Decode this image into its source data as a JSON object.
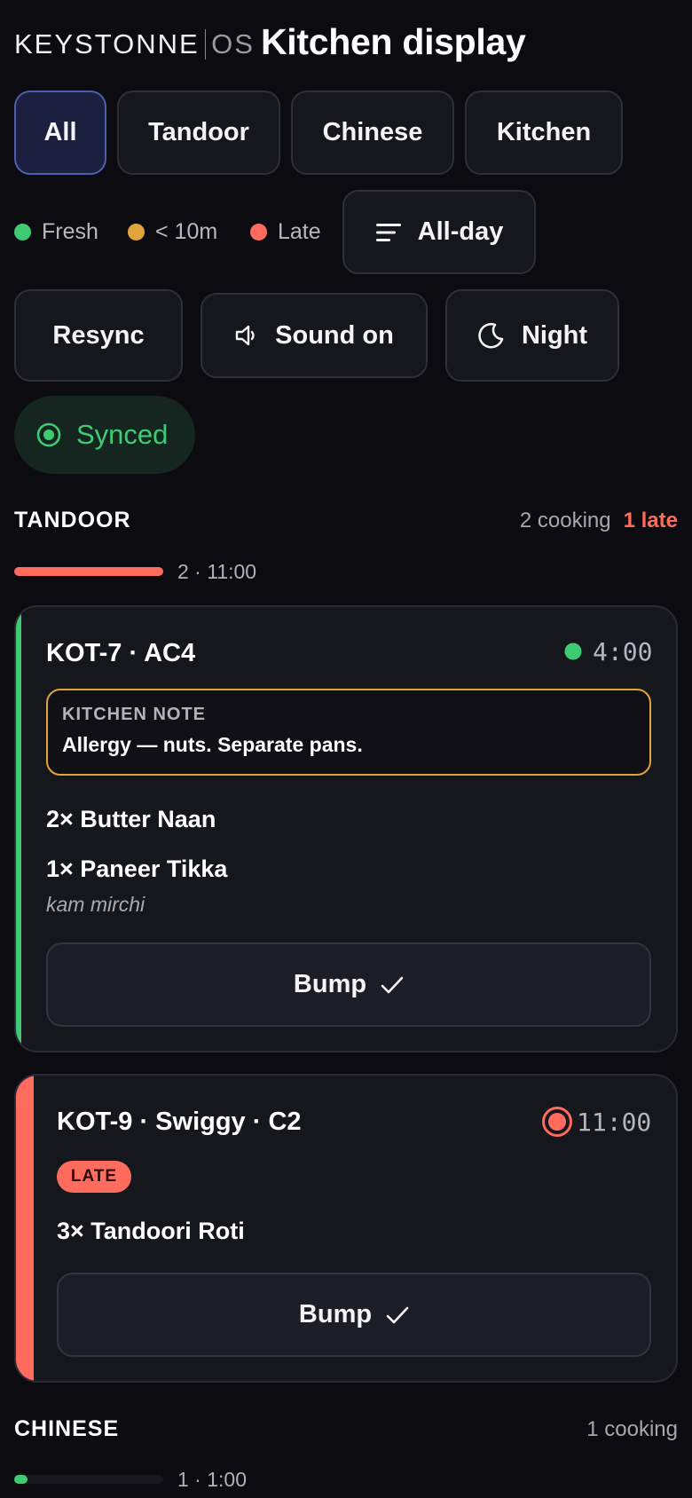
{
  "header": {
    "brand": "KEYSTONNE",
    "brand_suffix": "OS",
    "title": "Kitchen display"
  },
  "stations": [
    {
      "label": "All",
      "active": true
    },
    {
      "label": "Tandoor",
      "active": false
    },
    {
      "label": "Chinese",
      "active": false
    },
    {
      "label": "Kitchen",
      "active": false
    }
  ],
  "legend": [
    {
      "label": "Fresh",
      "color": "#3fcb74"
    },
    {
      "label": "< 10m",
      "color": "#e0a43a"
    },
    {
      "label": "Late",
      "color": "#ff6b5c"
    }
  ],
  "controls": {
    "allday_label": "All-day",
    "resync_label": "Resync",
    "sound_label": "Sound on",
    "night_label": "Night",
    "sync_status": "Synced"
  },
  "sections": [
    {
      "title": "TANDOOR",
      "cooking": "2 cooking",
      "late": "1 late",
      "progress_label": "2 · 11:00",
      "progress_fraction": 1.0,
      "progress_color": "#ff6b5c",
      "tickets": [
        {
          "title": "KOT-7 · AC4",
          "timer": "4:00",
          "status_color": "#3fcb74",
          "note_label": "KITCHEN NOTE",
          "note_text": "Allergy — nuts. Separate pans.",
          "items": [
            {
              "text": "2× Butter Naan"
            },
            {
              "text": "1× Paneer Tikka",
              "modifier": "kam mirchi"
            }
          ],
          "bump_label": "Bump"
        },
        {
          "title": "KOT-9 · Swiggy · C2",
          "timer": "11:00",
          "status_color": "#ff6b5c",
          "badge": "LATE",
          "items": [
            {
              "text": "3× Tandoori Roti"
            }
          ],
          "bump_label": "Bump"
        }
      ]
    },
    {
      "title": "CHINESE",
      "cooking": "1 cooking",
      "progress_label": "1 · 1:00",
      "progress_fraction": 0.09,
      "progress_color": "#3fcb74"
    }
  ]
}
